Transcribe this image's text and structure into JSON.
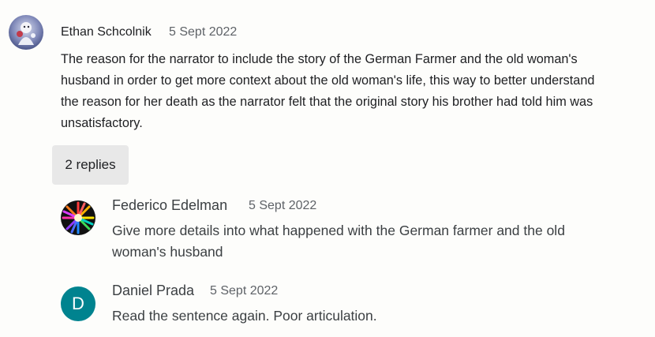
{
  "comment": {
    "author": "Ethan Schcolnik",
    "date": "5 Sept 2022",
    "avatar_icon": "snowy-figure-avatar",
    "lines": [
      "The reason for the narrator to include the story of the German Farmer and the old woman's",
      "husband in order to get more context about the old woman's life, this way to better understand",
      "the reason for her death as the narrator felt that the original story his brother had told him was",
      "unsatisfactory."
    ]
  },
  "replies_button": {
    "label": "2 replies"
  },
  "replies": [
    {
      "author": "Federico Edelman",
      "date": "5 Sept 2022",
      "avatar_icon": "colorful-burst-avatar",
      "lines": [
        "Give more details into what happened with the German farmer and the old",
        "woman's husband"
      ]
    },
    {
      "author": "Daniel Prada",
      "date": "5 Sept 2022",
      "avatar_letter": "D",
      "avatar_color": "#00838f",
      "lines": [
        "Read the sentence again. Poor articulation."
      ]
    }
  ]
}
